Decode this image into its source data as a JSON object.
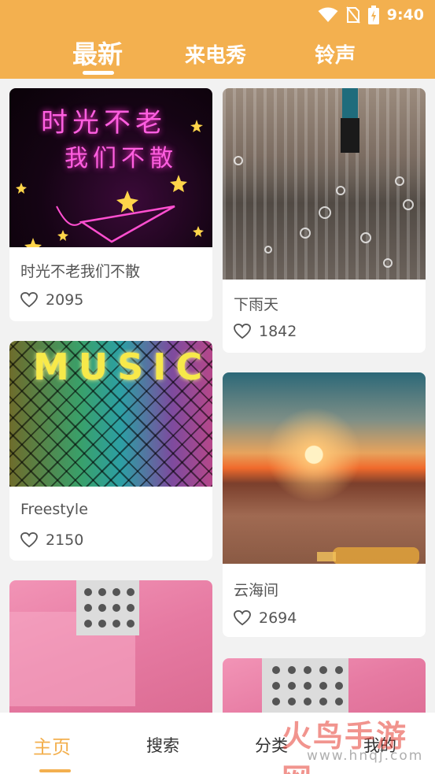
{
  "status_bar": {
    "time": "9:40"
  },
  "top_tabs": [
    {
      "label": "最新",
      "active": true
    },
    {
      "label": "来电秀",
      "active": false
    },
    {
      "label": "铃声",
      "active": false
    }
  ],
  "cards": [
    {
      "title": "时光不老我们不散",
      "likes": "2095",
      "image_text_line1": "时光不老",
      "image_text_line2": "我们不散"
    },
    {
      "title": "下雨天",
      "likes": "1842"
    },
    {
      "title": "Freestyle",
      "likes": "2150",
      "image_text": "MUSIC"
    },
    {
      "title": "云海间",
      "likes": "2694"
    },
    {
      "title": "",
      "likes": ""
    },
    {
      "title": "",
      "likes": ""
    }
  ],
  "bottom_nav": [
    {
      "label": "主页",
      "active": true
    },
    {
      "label": "搜索",
      "active": false
    },
    {
      "label": "分类",
      "active": false
    },
    {
      "label": "我的",
      "active": false
    }
  ],
  "watermark": {
    "main": "火鸟手游网",
    "sub": "www.hnqj.com"
  },
  "colors": {
    "accent": "#f3b04f",
    "card_bg": "#ffffff",
    "page_bg": "#f2f2f2"
  },
  "icons": [
    "wifi-icon",
    "no-sim-icon",
    "battery-icon",
    "heart-icon"
  ]
}
